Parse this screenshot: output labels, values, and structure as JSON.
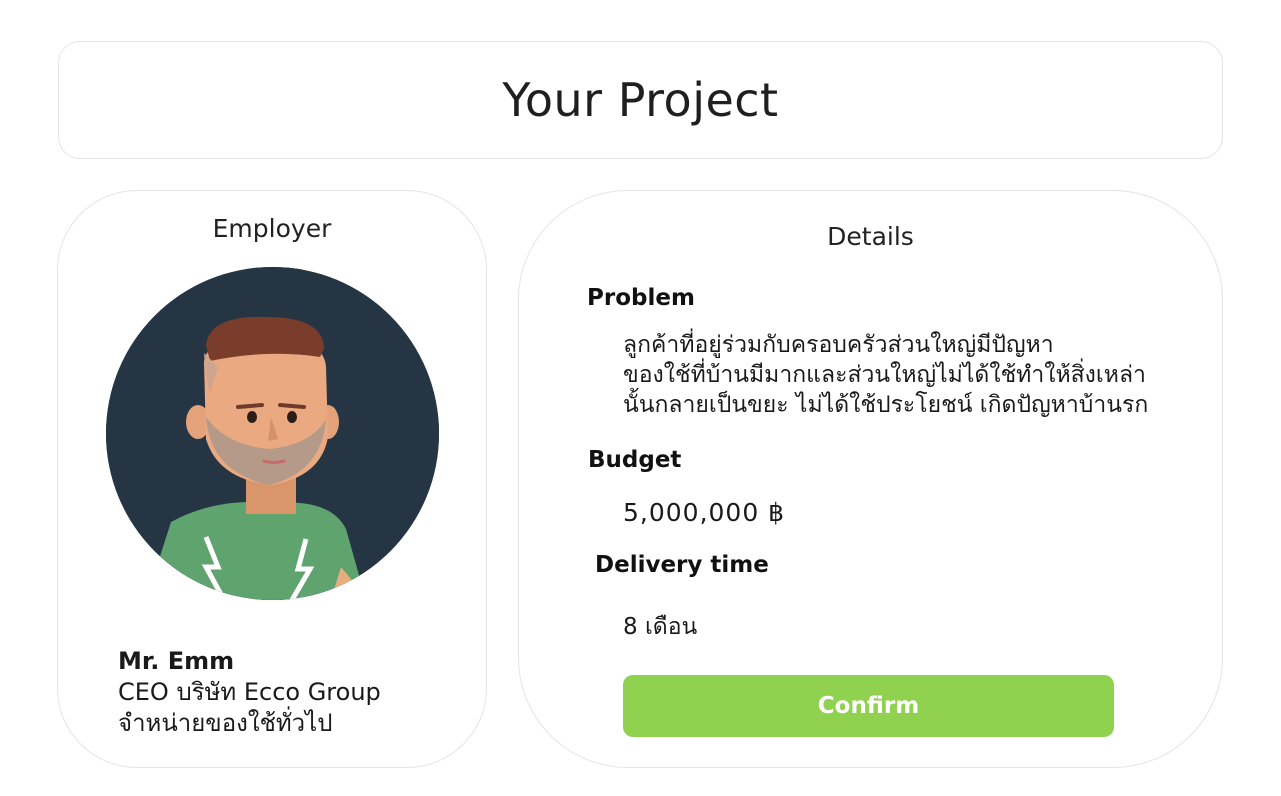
{
  "header": {
    "title": "Your Project"
  },
  "employer": {
    "title": "Employer",
    "name": "Mr. Emm",
    "position": "CEO บริษัท Ecco Group",
    "business": "จำหน่ายของใช้ทั่วไป",
    "avatar_icon": "person-avatar-icon"
  },
  "details": {
    "title": "Details",
    "problem_label": "Problem",
    "problem_lines": [
      "ลูกค้าที่อยู่ร่วมกับครอบครัวส่วนใหญ่มีปัญหา",
      "ของใช้ที่บ้านมีมากและส่วนใหญ่ไม่ได้ใช้ทำให้สิ่งเหล่า",
      "นั้นกลายเป็นขยะ ไม่ได้ใช้ประโยชน์ เกิดปัญหาบ้านรก"
    ],
    "budget_label": "Budget",
    "budget_value": "5,000,000 ฿",
    "delivery_label": "Delivery time",
    "delivery_value": "8 เดือน",
    "confirm_label": "Confirm"
  },
  "colors": {
    "accent": "#90d14f",
    "avatar_background": "#253543",
    "border": "#e4e4e4"
  }
}
